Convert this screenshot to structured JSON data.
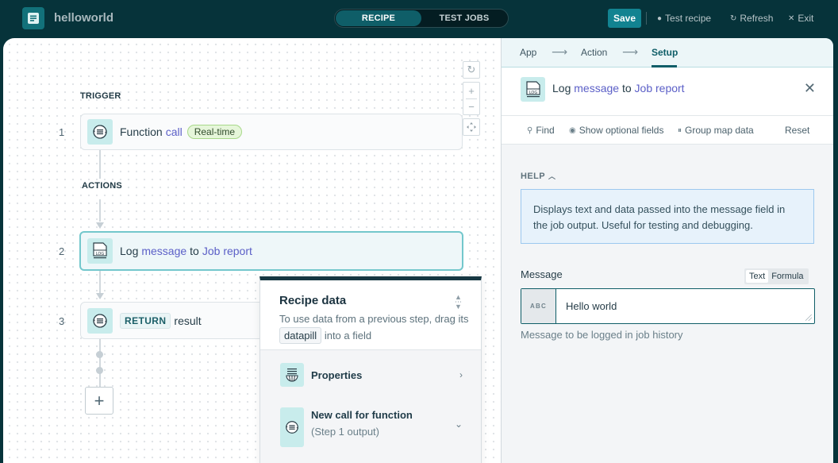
{
  "topbar": {
    "app_name": "helloworld",
    "tabs": [
      {
        "label": "RECIPE",
        "active": true
      },
      {
        "label": "TEST JOBS",
        "active": false
      }
    ],
    "save_label": "Save",
    "test_recipe_label": "Test recipe",
    "refresh_label": "Refresh",
    "exit_label": "Exit"
  },
  "canvas": {
    "trigger_label": "TRIGGER",
    "actions_label": "ACTIONS",
    "steps": [
      {
        "number": "1",
        "prefix": "Function",
        "keyword": "call",
        "badge": "Real-time",
        "icon": "function-call-icon"
      },
      {
        "number": "2",
        "prefix": "Log",
        "keyword": "message",
        "middle": "to",
        "keyword2": "Job report",
        "icon": "log-icon",
        "active": true
      },
      {
        "number": "3",
        "badge": "RETURN",
        "text": "result",
        "icon": "function-return-icon"
      }
    ],
    "add_step_symbol": "+",
    "zoom_controls": {
      "reset": "↻",
      "zoom_in": "+",
      "zoom_out": "−",
      "fit": "⤧"
    }
  },
  "recipe_data": {
    "title": "Recipe data",
    "desc_prefix": "To use data from a previous step, drag its",
    "datapill_label": "datapill",
    "desc_suffix": "into a field",
    "items": [
      {
        "label": "Properties",
        "icon": "properties-icon",
        "chevron": "›"
      },
      {
        "label": "New call for function",
        "sublabel": "(Step 1 output)",
        "icon": "function-call-icon",
        "chevron": "⌄"
      }
    ]
  },
  "right_panel": {
    "wizard_tabs": [
      {
        "label": "App",
        "active": false
      },
      {
        "label": "Action",
        "active": false
      },
      {
        "label": "Setup",
        "active": true
      }
    ],
    "wizard_arrow": "⟶",
    "header": {
      "prefix": "Log",
      "keyword": "message",
      "middle": "to",
      "keyword2": "Job report"
    },
    "toolbar": {
      "find_label": "Find",
      "optional_fields_label": "Show optional fields",
      "group_map_label": "Group map data",
      "reset_label": "Reset"
    },
    "help": {
      "label": "HELP",
      "text": "Displays text and data passed into the message field in the job output. Useful for testing and debugging."
    },
    "message_field": {
      "label": "Message",
      "modes": [
        {
          "label": "Text",
          "active": true
        },
        {
          "label": "Formula",
          "active": false
        }
      ],
      "type_badge": "ABC",
      "value": "Hello world",
      "hint": "Message to be logged in job history"
    }
  },
  "colors": {
    "topbar_bg": "#06333a",
    "accent": "#128391",
    "keyword": "#5b5fc7",
    "active_step_border": "#73c7cc",
    "icon_bg": "#c8ecec"
  }
}
